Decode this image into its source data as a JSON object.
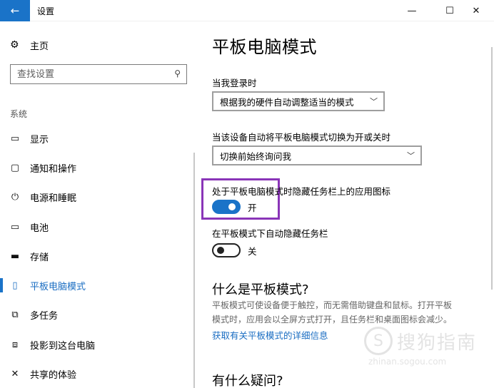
{
  "window": {
    "title": "设置",
    "back_glyph": "←",
    "min_glyph": "—",
    "max_glyph": "☐",
    "close_glyph": "✕"
  },
  "sidebar": {
    "home": {
      "icon": "gear-icon",
      "glyph": "⚙",
      "label": "主页"
    },
    "search": {
      "placeholder": "查找设置",
      "icon_glyph": "⚲"
    },
    "section_label": "系统",
    "items": [
      {
        "id": "display",
        "icon": "monitor-icon",
        "glyph": "▭",
        "label": "显示",
        "selected": false
      },
      {
        "id": "notifications",
        "icon": "message-icon",
        "glyph": "▢",
        "label": "通知和操作",
        "selected": false
      },
      {
        "id": "power",
        "icon": "power-icon",
        "glyph": "⏻",
        "label": "电源和睡眠",
        "selected": false
      },
      {
        "id": "battery",
        "icon": "battery-icon",
        "glyph": "▭",
        "label": "电池",
        "selected": false
      },
      {
        "id": "storage",
        "icon": "storage-icon",
        "glyph": "▬",
        "label": "存储",
        "selected": false
      },
      {
        "id": "tablet",
        "icon": "tablet-icon",
        "glyph": "▯",
        "label": "平板电脑模式",
        "selected": true
      },
      {
        "id": "multitask",
        "icon": "multitask-icon",
        "glyph": "⧉",
        "label": "多任务",
        "selected": false
      },
      {
        "id": "project",
        "icon": "projector-icon",
        "glyph": "⧈",
        "label": "投影到这台电脑",
        "selected": false
      },
      {
        "id": "shared",
        "icon": "shared-icon",
        "glyph": "✕",
        "label": "共享的体验",
        "selected": false
      }
    ]
  },
  "main": {
    "title": "平板电脑模式",
    "signin_label": "当我登录时",
    "signin_value": "根据我的硬件自动调整适当的模式",
    "switch_label": "当该设备自动将平板电脑模式切换为开或关时",
    "switch_value": "切换前始终询问我",
    "hide_icons_label": "处于平板电脑模式时隐藏任务栏上的应用图标",
    "hide_icons_state": "开",
    "hide_icons_on": true,
    "hide_taskbar_label": "在平板模式下自动隐藏任务栏",
    "hide_taskbar_state": "关",
    "hide_taskbar_on": false,
    "what_heading": "什么是平板模式?",
    "what_line1": "平板模式可使设备便于触控，而无需借助键盘和鼠标。打开平板",
    "what_line2": "模式时，应用会以全屏方式打开，且任务栏和桌面图标会减少。",
    "learn_more": "获取有关平板模式的详细信息",
    "question_heading": "有什么疑问?"
  },
  "watermark": {
    "glyph": "S",
    "text": "搜狗指南",
    "url": "zhinan.sogou.com"
  },
  "colors": {
    "accent": "#1a73c8",
    "highlight": "#8a35b8"
  }
}
